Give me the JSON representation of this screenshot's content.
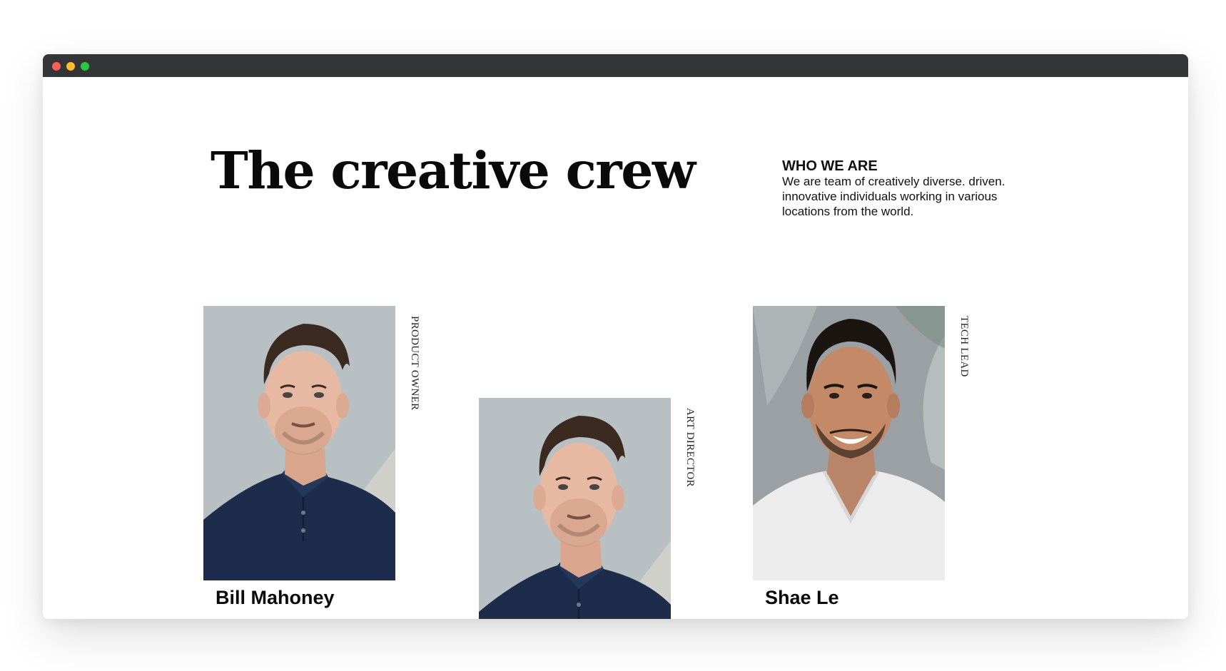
{
  "window": {
    "traffic_lights": [
      {
        "name": "close",
        "color": "#ff5f56"
      },
      {
        "name": "minimize",
        "color": "#ffbd2e"
      },
      {
        "name": "maximize",
        "color": "#27c93f"
      }
    ]
  },
  "hero": {
    "title": "The creative crew"
  },
  "about": {
    "heading": "WHO WE ARE",
    "text": "We are team of creatively diverse. driven. innovative individuals working in various locations from the world."
  },
  "team": [
    {
      "name": "Bill Mahoney",
      "role": "PRODUCT OWNER",
      "photo_icon": "portrait-man-navy-polo"
    },
    {
      "name": "",
      "role": "ART DIRECTOR",
      "photo_icon": "portrait-man-navy-polo"
    },
    {
      "name": "Shae Le",
      "role": "TECH LEAD",
      "photo_icon": "portrait-man-white-tshirt"
    }
  ],
  "colors": {
    "titlebar": "#333537",
    "text": "#0a0a0a"
  }
}
